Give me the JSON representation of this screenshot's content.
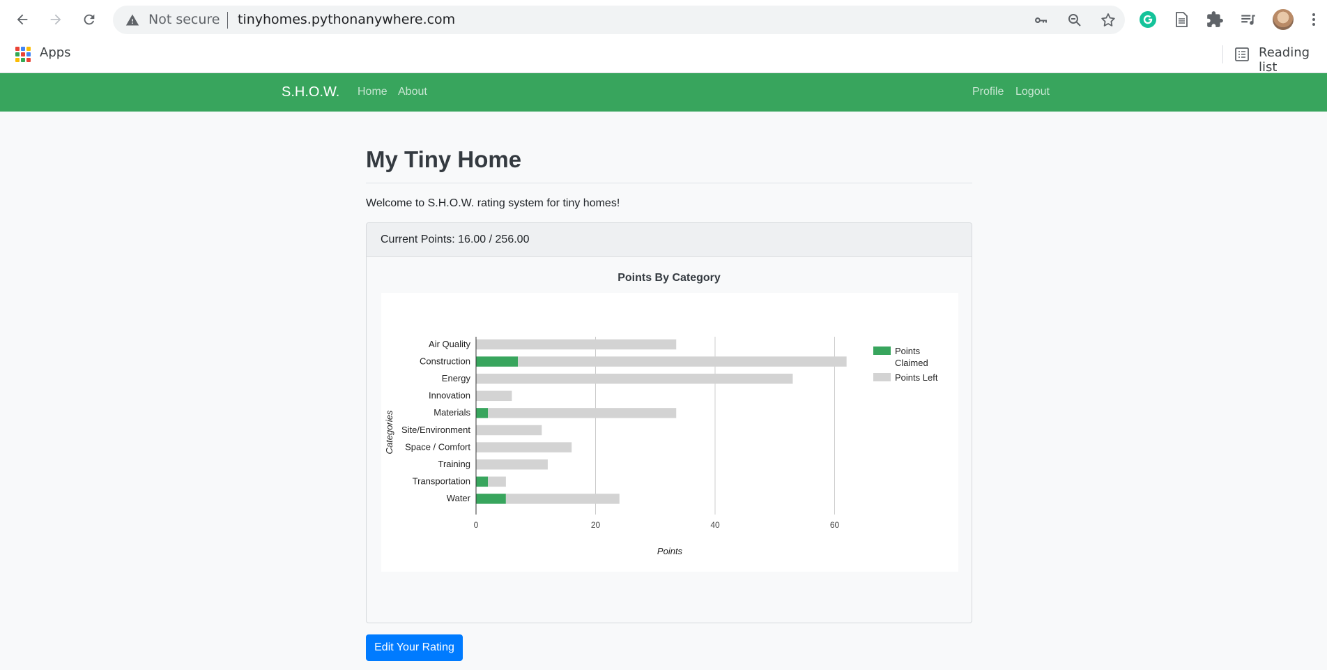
{
  "browser": {
    "security_status": "Not secure",
    "url": "tinyhomes.pythonanywhere.com",
    "bookmarks": {
      "apps_label": "Apps",
      "reading_list_label": "Reading list"
    },
    "icons": [
      "back-icon",
      "forward-icon",
      "reload-icon",
      "warning-icon",
      "key-icon",
      "zoom-out-icon",
      "star-icon",
      "grammarly-icon",
      "document-icon",
      "puzzle-icon",
      "media-queue-icon",
      "avatar",
      "more-icon",
      "apps-icon",
      "reading-list-icon"
    ]
  },
  "navbar": {
    "brand": "S.H.O.W.",
    "links": [
      "Home",
      "About"
    ],
    "right_links": [
      "Profile",
      "Logout"
    ],
    "color": "#38a55d"
  },
  "page": {
    "title": "My Tiny Home",
    "welcome": "Welcome to S.H.O.W. rating system for tiny homes!",
    "current_points": "Current Points: 16.00 / 256.00",
    "edit_button": "Edit Your Rating"
  },
  "chart_data": {
    "type": "bar",
    "orientation": "horizontal",
    "stacked": true,
    "title": "Points By Category",
    "xlabel": "Points",
    "ylabel": "Categories",
    "xlim": [
      0,
      70
    ],
    "xticks": [
      0,
      20,
      40,
      60
    ],
    "grid": true,
    "legend_position": "right",
    "categories": [
      "Air Quality",
      "Construction",
      "Energy",
      "Innovation",
      "Materials",
      "Site/Environment",
      "Space / Comfort",
      "Training",
      "Transportation",
      "Water"
    ],
    "series": [
      {
        "name": "Points Claimed",
        "color": "#38a55d",
        "values": [
          0,
          7,
          0,
          0,
          2,
          0,
          0,
          0,
          2,
          5
        ]
      },
      {
        "name": "Points Left",
        "color": "#d3d3d3",
        "values": [
          33.5,
          55,
          53,
          6,
          31.5,
          11,
          16,
          12,
          3,
          19
        ]
      }
    ]
  }
}
